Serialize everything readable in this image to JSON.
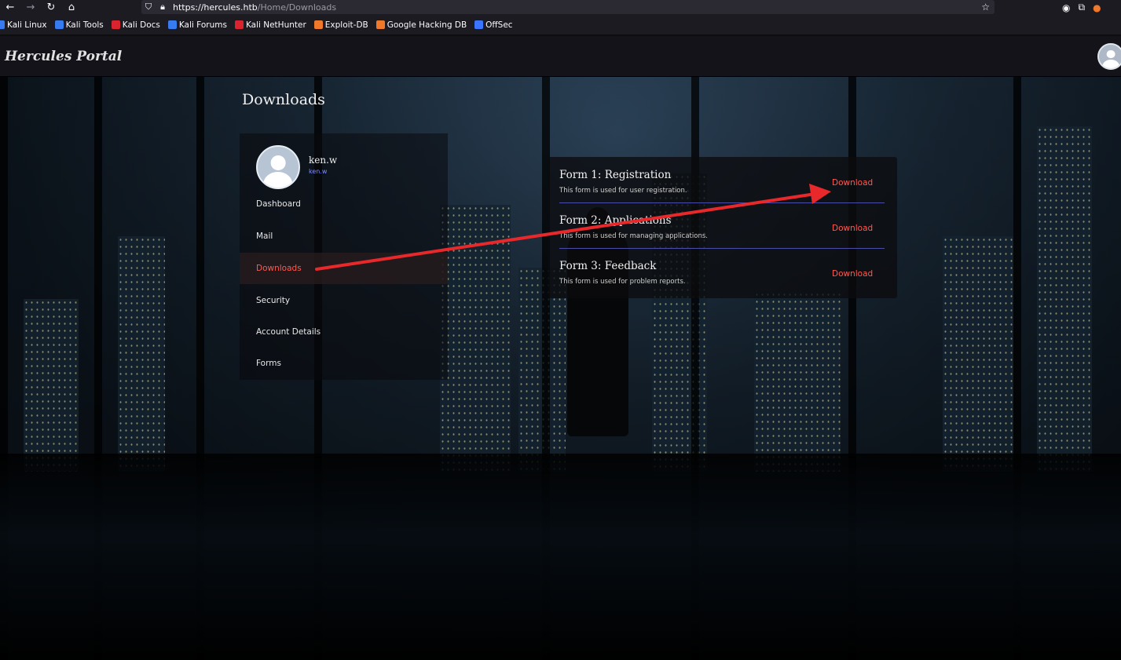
{
  "browser": {
    "url_host": "https://hercules.htb",
    "url_path": "/Home/Downloads",
    "bookmarks": [
      {
        "label": "Kali Linux",
        "color": "#367bf0"
      },
      {
        "label": "Kali Tools",
        "color": "#367bf0"
      },
      {
        "label": "Kali Docs",
        "color": "#d9232e"
      },
      {
        "label": "Kali Forums",
        "color": "#367bf0"
      },
      {
        "label": "Kali NetHunter",
        "color": "#d9232e"
      },
      {
        "label": "Exploit-DB",
        "color": "#f0782a"
      },
      {
        "label": "Google Hacking DB",
        "color": "#f0782a"
      },
      {
        "label": "OffSec",
        "color": "#3b74ff"
      }
    ]
  },
  "header": {
    "title": "Hercules Portal"
  },
  "page": {
    "heading": "Downloads"
  },
  "user": {
    "name": "ken.w",
    "handle": "ken.w"
  },
  "sidebar": {
    "items": [
      {
        "label": "Dashboard",
        "active": false
      },
      {
        "label": "Mail",
        "active": false
      },
      {
        "label": "Downloads",
        "active": true
      },
      {
        "label": "Security",
        "active": false
      },
      {
        "label": "Account Details",
        "active": false
      },
      {
        "label": "Forms",
        "active": false
      }
    ]
  },
  "forms": [
    {
      "title": "Form 1: Registration",
      "description": "This form is used for user registration.",
      "action": "Download"
    },
    {
      "title": "Form 2: Applications",
      "description": "This form is used for managing applications.",
      "action": "Download"
    },
    {
      "title": "Form 3: Feedback",
      "description": "This form is used for problem reports.",
      "action": "Download"
    }
  ],
  "colors": {
    "accent": "#ff5a52",
    "annotation_arrow": "#e8282a",
    "separator": "#4b4ea8"
  }
}
